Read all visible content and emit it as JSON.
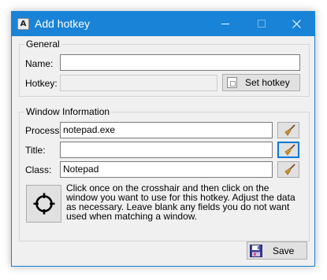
{
  "window": {
    "title": "Add hotkey",
    "icon_letter": "A",
    "controls": [
      "minimize-icon",
      "maximize-icon",
      "close-icon"
    ]
  },
  "general": {
    "legend": "General",
    "name_label": "Name:",
    "name_value": "",
    "hotkey_label": "Hotkey:",
    "hotkey_value": "",
    "set_hotkey_label": "Set hotkey"
  },
  "window_info": {
    "legend": "Window Information",
    "process_label": "Process",
    "process_value": "notepad.exe",
    "title_label": "Title:",
    "title_value": "",
    "class_label": "Class:",
    "class_value": "Notepad",
    "instructions": "Click once on the crosshair and then click on the window you want to use for this hotkey.  Adjust the data as necessary.  Leave blank any fields you do not want used when matching a window."
  },
  "actions": {
    "save_label": "Save"
  },
  "colors": {
    "titlebar": "#1883d7",
    "dialog_bg": "#f0f0f0",
    "focus_border": "#0078d7"
  },
  "icons": [
    "app-icon",
    "broom-icon",
    "crosshair-icon",
    "floppy-disk-icon",
    "keyboard-key-icon"
  ]
}
